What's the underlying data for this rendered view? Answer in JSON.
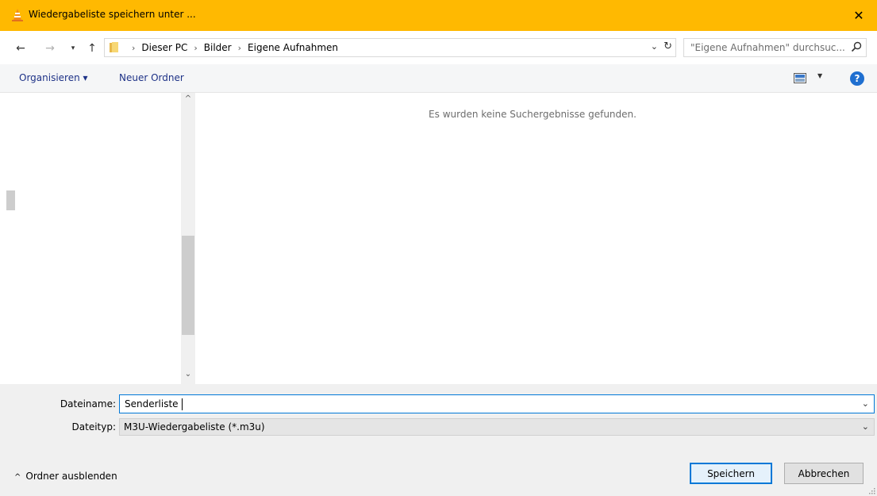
{
  "window": {
    "title": "Wiedergabeliste speichern unter ...",
    "close_glyph": "✕",
    "app_icon": "vlc-cone-icon",
    "title_bg": "#ffb901"
  },
  "address": {
    "back_glyph": "←",
    "forward_glyph": "→",
    "recent_glyph": "▾",
    "up_glyph": "↑",
    "crumbs": [
      "Dieser PC",
      "Bilder",
      "Eigene Aufnahmen"
    ],
    "separator": "›",
    "dropdown_glyph": "⌄",
    "refresh_glyph": "↻"
  },
  "search": {
    "placeholder": "\"Eigene Aufnahmen\" durchsuc..."
  },
  "toolbar": {
    "organize_label": "Organisieren ▾",
    "new_folder_label": "Neuer Ordner",
    "view_dropdown_glyph": "▼",
    "help_glyph": "?"
  },
  "scrollbar": {
    "up_glyph": "^",
    "down_glyph": "⌄"
  },
  "content": {
    "empty_message": "Es wurden keine Suchergebnisse gefunden."
  },
  "form": {
    "filename_label": "Dateiname:",
    "filename_value": "Senderliste",
    "filetype_label": "Dateityp:",
    "filetype_value": "M3U-Wiedergabeliste (*.m3u)",
    "combo_arrow": "⌄"
  },
  "footer": {
    "hide_folders_chevron": "^",
    "hide_folders_label": "Ordner ausblenden",
    "save_label": "Speichern",
    "cancel_label": "Abbrechen",
    "accent": "#0078d7"
  }
}
